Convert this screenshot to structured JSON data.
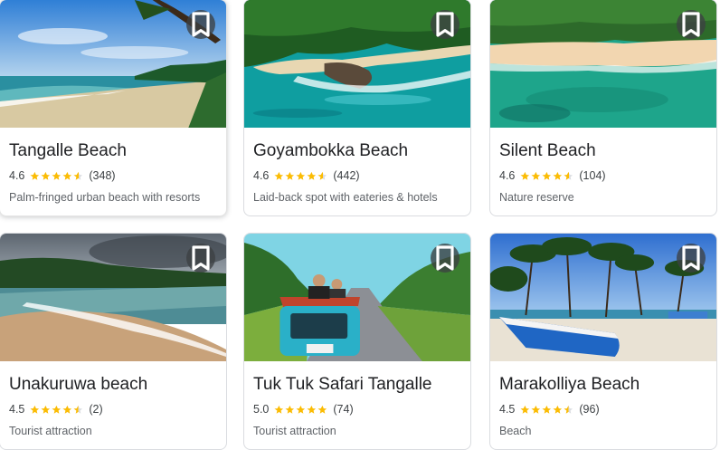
{
  "colors": {
    "star": "#fbbc04",
    "star_empty": "#dadce0",
    "title": "#202124",
    "meta": "#5f6368"
  },
  "cards": [
    {
      "name": "Tangalle Beach",
      "rating": "4.6",
      "rating_value": 4.6,
      "reviews": "(348)",
      "description": "Palm-fringed urban beach with resorts",
      "save_icon": "bookmark-icon"
    },
    {
      "name": "Goyambokka Beach",
      "rating": "4.6",
      "rating_value": 4.6,
      "reviews": "(442)",
      "description": "Laid-back spot with eateries & hotels",
      "save_icon": "bookmark-icon"
    },
    {
      "name": "Silent Beach",
      "rating": "4.6",
      "rating_value": 4.6,
      "reviews": "(104)",
      "description": "Nature reserve",
      "save_icon": "bookmark-icon"
    },
    {
      "name": "Unakuruwa beach",
      "rating": "4.5",
      "rating_value": 4.5,
      "reviews": "(2)",
      "description": "Tourist attraction",
      "save_icon": "bookmark-icon"
    },
    {
      "name": "Tuk Tuk Safari Tangalle",
      "rating": "5.0",
      "rating_value": 5.0,
      "reviews": "(74)",
      "description": "Tourist attraction",
      "save_icon": "bookmark-icon"
    },
    {
      "name": "Marakolliya Beach",
      "rating": "4.5",
      "rating_value": 4.5,
      "reviews": "(96)",
      "description": "Beach",
      "save_icon": "bookmark-icon"
    }
  ]
}
